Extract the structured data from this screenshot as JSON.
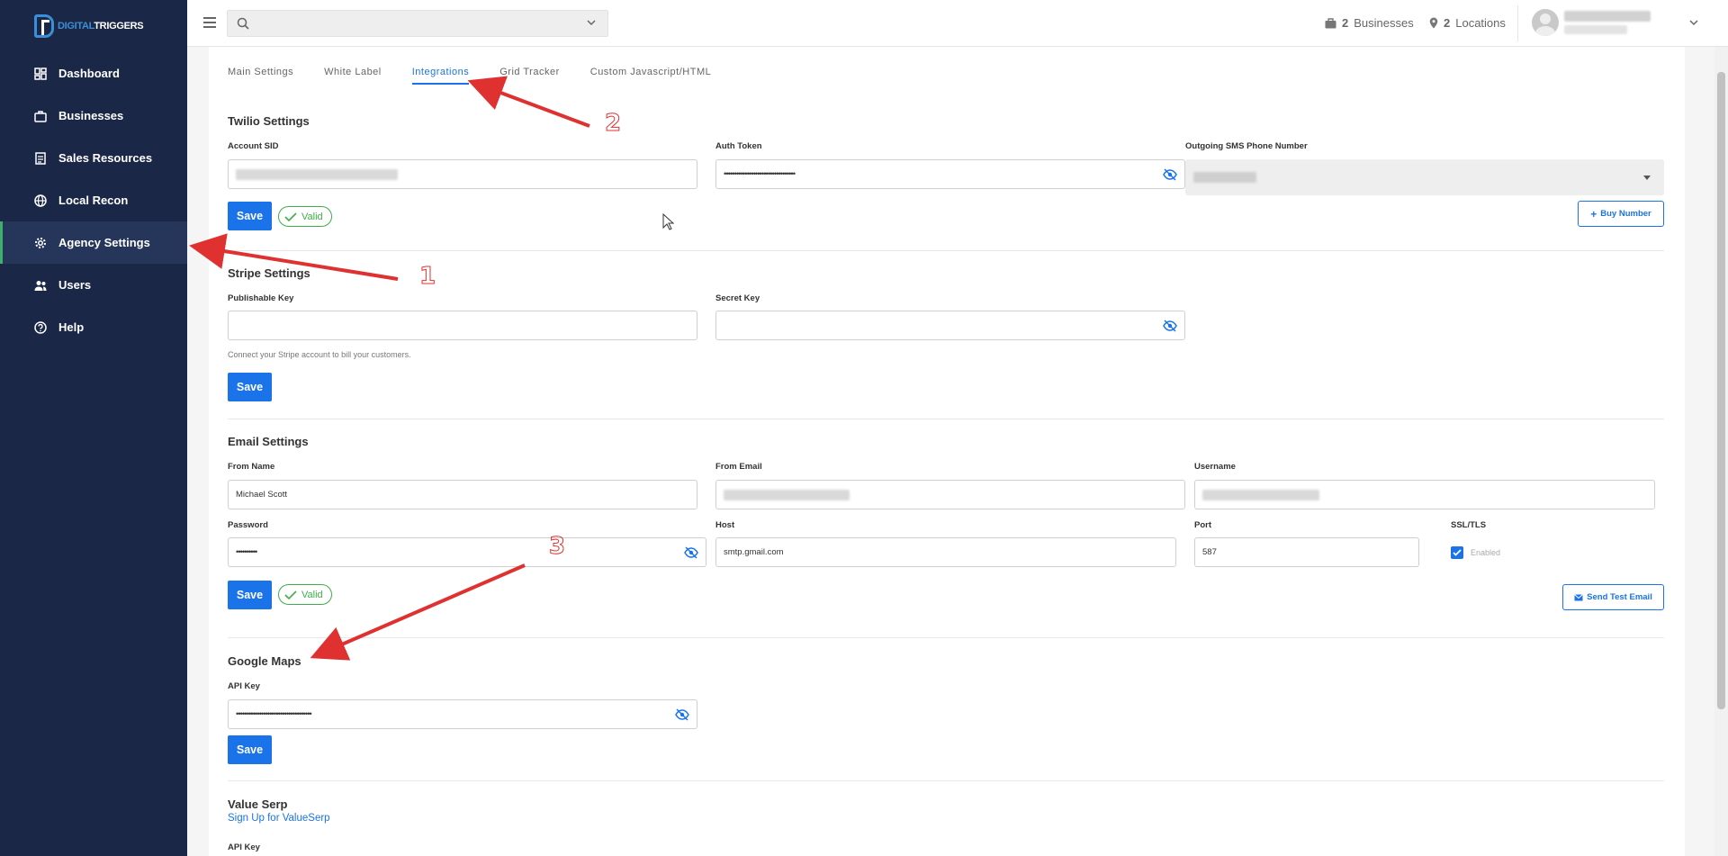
{
  "brand": {
    "logo_text_a": "DIGITAL",
    "logo_text_b": "TRIGGERS"
  },
  "sidebar": {
    "items": [
      {
        "label": "Dashboard",
        "icon": "dashboard-icon"
      },
      {
        "label": "Businesses",
        "icon": "briefcase-icon"
      },
      {
        "label": "Sales Resources",
        "icon": "document-icon"
      },
      {
        "label": "Local Recon",
        "icon": "globe-icon"
      },
      {
        "label": "Agency Settings",
        "icon": "gear-icon",
        "active": true
      },
      {
        "label": "Users",
        "icon": "users-icon"
      },
      {
        "label": "Help",
        "icon": "help-icon"
      }
    ]
  },
  "topbar": {
    "search_value": "",
    "businesses_count": "2",
    "businesses_label": "Businesses",
    "locations_count": "2",
    "locations_label": "Locations"
  },
  "tabs": [
    "Main Settings",
    "White Label",
    "Integrations",
    "Grid Tracker",
    "Custom Javascript/HTML"
  ],
  "active_tab": "Integrations",
  "twilio": {
    "title": "Twilio Settings",
    "account_sid_label": "Account SID",
    "auth_token_label": "Auth Token",
    "auth_token_value": "••••••••••••••••••••••••••••••••••",
    "phone_label": "Outgoing SMS Phone Number",
    "save": "Save",
    "valid": "Valid",
    "buy_number": "Buy Number"
  },
  "stripe": {
    "title": "Stripe Settings",
    "publishable_label": "Publishable Key",
    "secret_label": "Secret Key",
    "help": "Connect your Stripe account to bill your customers.",
    "save": "Save"
  },
  "email": {
    "title": "Email Settings",
    "from_name_label": "From Name",
    "from_name_value": "Michael Scott",
    "from_email_label": "From Email",
    "username_label": "Username",
    "password_label": "Password",
    "password_value": "••••••••••",
    "host_label": "Host",
    "host_value": "smtp.gmail.com",
    "port_label": "Port",
    "port_value": "587",
    "ssl_label": "SSL/TLS",
    "ssl_enabled_label": "Enabled",
    "save": "Save",
    "valid": "Valid",
    "send_test": "Send Test Email"
  },
  "google_maps": {
    "title": "Google Maps",
    "api_key_label": "API Key",
    "api_key_value": "••••••••••••••••••••••••••••••••••••",
    "save": "Save"
  },
  "value_serp": {
    "title": "Value Serp",
    "signup_link": "Sign Up for ValueSerp",
    "api_key_label": "API Key"
  },
  "annotations": {
    "one": "1",
    "two": "2",
    "three": "3"
  },
  "colors": {
    "sidebar": "#1b2746",
    "accent": "#1a73e8",
    "valid": "#3fae4a",
    "annotation": "#e03131"
  }
}
